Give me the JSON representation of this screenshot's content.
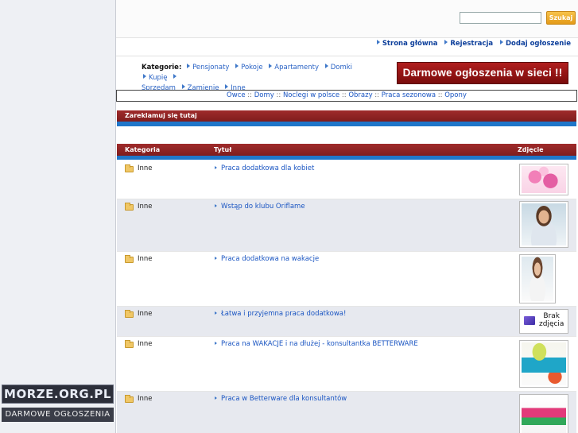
{
  "search": {
    "placeholder": "",
    "button_label": "Szukaj"
  },
  "topnav": [
    {
      "label": "Strona główna"
    },
    {
      "label": "Rejestracja"
    },
    {
      "label": "Dodaj ogłoszenie"
    }
  ],
  "categories": {
    "label": "Kategorie:",
    "items": [
      "Pensjonaty",
      "Pokoje",
      "Apartamenty",
      "Domki",
      "Kupię",
      "Sprzedam",
      "Zamienię",
      "Inne"
    ]
  },
  "banner": {
    "text": "Darmowe ogłoszenia w sieci !!"
  },
  "linkbar": [
    "Owce",
    "Domy",
    "Noclegi w polsce",
    "Obrazy",
    "Praca sezonowa",
    "Opony"
  ],
  "adbar": {
    "title": "Zareklamuj się tutaj"
  },
  "table": {
    "headers": {
      "category": "Kategoria",
      "title": "Tytuł",
      "photo": "Zdjęcie"
    },
    "rows": [
      {
        "category": "Inne",
        "title": "Praca dodatkowa dla kobiet",
        "photo_icon": "flowers-photo"
      },
      {
        "category": "Inne",
        "title": "Wstąp do klubu Oriflame",
        "photo_icon": "woman-wellness-photo"
      },
      {
        "category": "Inne",
        "title": "Praca dodatkowa na wakacje",
        "photo_icon": "woman-photo"
      },
      {
        "category": "Inne",
        "title": "Łatwa i przyjemna praca dodatkowa!",
        "photo_icon": "no-photo",
        "photo_text_1": "Brak",
        "photo_text_2": "zdjęcia"
      },
      {
        "category": "Inne",
        "title": "Praca na WAKACJE i na dłużej - konsultantka BETTERWARE",
        "photo_icon": "products-photo"
      },
      {
        "category": "Inne",
        "title": "Praca w Betterware dla konsultantów",
        "photo_icon": "containers-photo"
      }
    ]
  },
  "logo": {
    "top": "MORZE.ORG.PL",
    "bottom": "DARMOWE OGŁOSZENIA"
  }
}
